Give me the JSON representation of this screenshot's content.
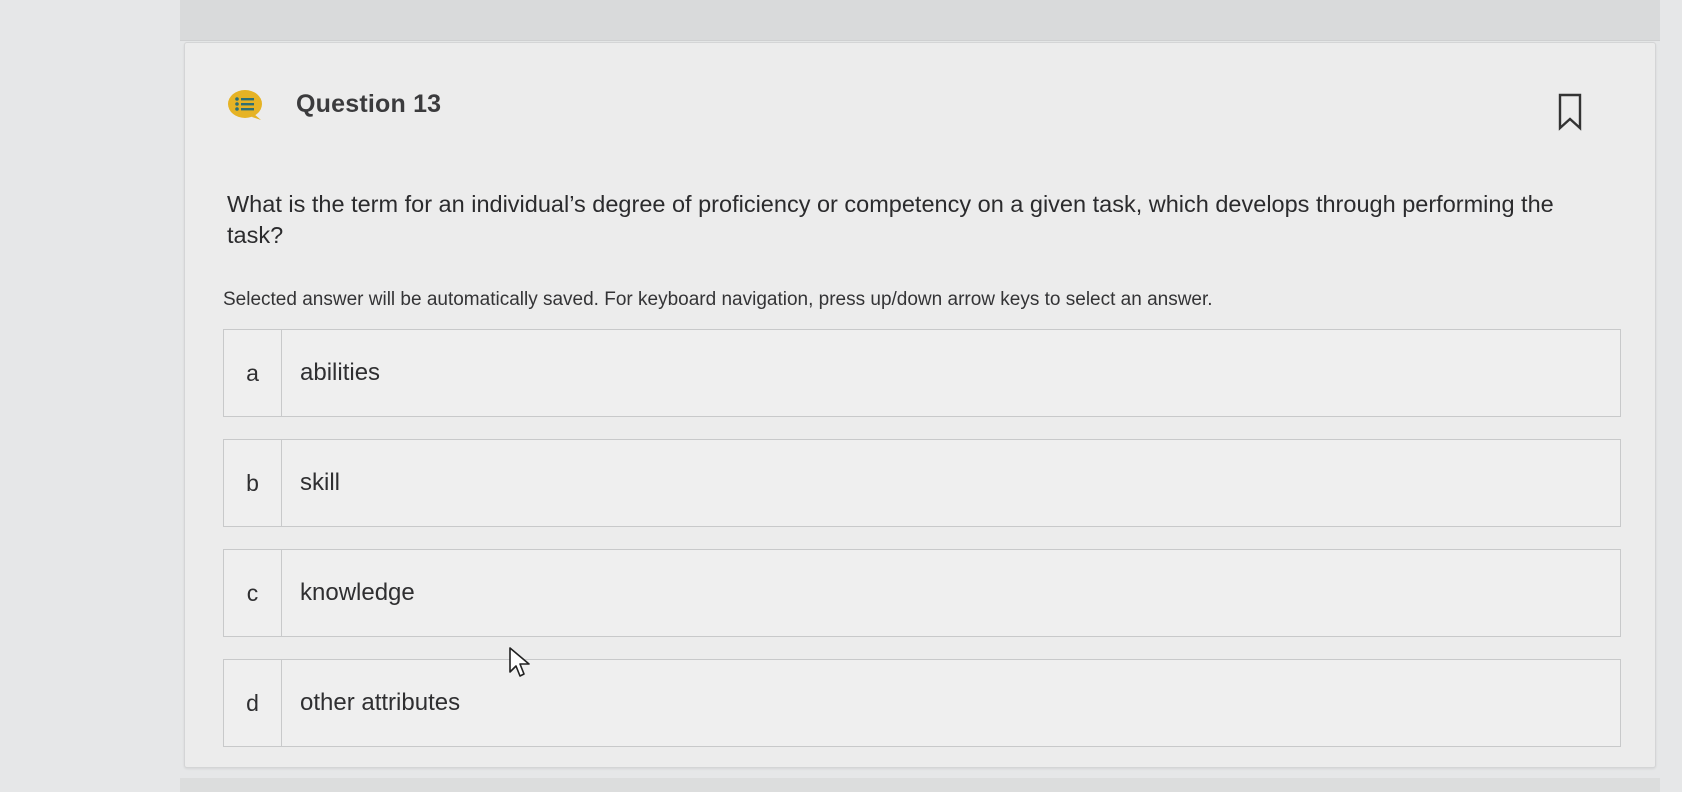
{
  "question": {
    "title": "Question 13",
    "text": "What is the term for an individual’s degree of proficiency or competency on a given task, which develops through performing the task?",
    "instructions": "Selected answer will be automatically saved. For keyboard navigation, press up/down arrow keys to select an answer.",
    "icon": "question-list-icon",
    "bookmark_icon": "bookmark-icon"
  },
  "options": [
    {
      "letter": "a",
      "text": "abilities"
    },
    {
      "letter": "b",
      "text": "skill"
    },
    {
      "letter": "c",
      "text": "knowledge"
    },
    {
      "letter": "d",
      "text": "other attributes"
    }
  ],
  "colors": {
    "page_background": "#e6e7e8",
    "card_background": "#ececec",
    "icon_teal": "#2e7f86",
    "icon_gold": "#e6b325",
    "border": "#c8c9ca"
  }
}
